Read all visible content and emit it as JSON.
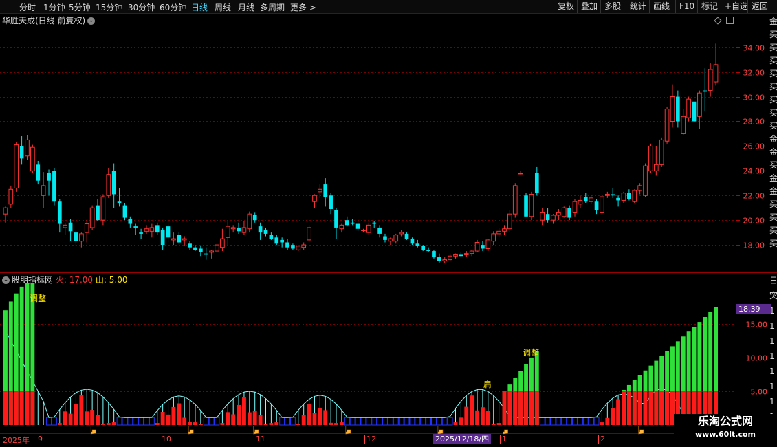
{
  "toolbar": {
    "left": [
      "分时",
      "1分钟",
      "5分钟",
      "15分钟",
      "30分钟",
      "60分钟",
      "日线",
      "周线",
      "月线",
      "多周期",
      "更多 >"
    ],
    "active_index": 6,
    "right": [
      "复权",
      "叠加",
      "多股",
      "统计",
      "画线",
      "F10",
      "标记",
      "+自选",
      "返回"
    ]
  },
  "stock_title": "华胜天成(日线 前复权)",
  "price_axis": {
    "labels": [
      "34.00",
      "32.00",
      "30.00",
      "28.00",
      "26.00",
      "24.00",
      "22.00",
      "20.00",
      "18.00"
    ],
    "values": [
      34,
      32,
      30,
      28,
      26,
      24,
      22,
      20,
      18
    ],
    "min": 16.0,
    "max": 35.6
  },
  "indicator": {
    "name": "股朋指标网",
    "fire_label": "火: 17.00",
    "mountain_label": "山: 5.00",
    "axis_labels": [
      "15.00",
      "10.00",
      "5.00"
    ],
    "axis_values": [
      15,
      10,
      5
    ],
    "max": 21.2,
    "current_value": "18.39",
    "annotations": [
      "调整",
      "调整",
      "肩"
    ],
    "right_partial": [
      "日",
      "突",
      "1",
      "1",
      "1",
      "1",
      "1",
      "1",
      "1",
      "1"
    ]
  },
  "right_partial_chars": [
    "金",
    "买",
    "买",
    "买",
    "买",
    "买",
    "买",
    "买",
    "买",
    "金",
    "金",
    "买",
    "金",
    "金",
    "买",
    "买",
    "买",
    "买"
  ],
  "dates": {
    "year": "2025年",
    "months": [
      "9",
      "10",
      "11",
      "12",
      "1",
      "2"
    ],
    "cursor": "2025/12/18/四"
  },
  "watermark": {
    "line1": "乐淘公式网",
    "line2": "www.60lt.com"
  },
  "colors": {
    "up": "#ff3333",
    "down": "#00e8f0",
    "green_bar": "#2fe03a",
    "red_bar": "#ff1a1a",
    "cyan_line": "#7fffff",
    "blue_box": "#2233ff",
    "grid": "#7a0000"
  },
  "chart_data": {
    "type": "candlestick",
    "candles": [
      [
        20.5,
        21.1,
        19.8,
        21.0
      ],
      [
        21.3,
        22.8,
        21.0,
        22.5
      ],
      [
        22.6,
        26.3,
        22.3,
        26.1
      ],
      [
        26.0,
        26.8,
        24.5,
        25.0
      ],
      [
        25.2,
        26.9,
        24.9,
        26.5
      ],
      [
        24.0,
        26.1,
        23.8,
        25.9
      ],
      [
        24.5,
        24.8,
        22.9,
        23.2
      ],
      [
        22.0,
        23.9,
        21.0,
        22.8
      ],
      [
        23.8,
        24.1,
        22.0,
        23.2
      ],
      [
        24.0,
        24.2,
        21.2,
        21.5
      ],
      [
        21.5,
        21.7,
        19.0,
        19.7
      ],
      [
        19.4,
        19.8,
        18.8,
        19.6
      ],
      [
        19.8,
        20.1,
        18.3,
        19.1
      ],
      [
        19.0,
        19.2,
        17.9,
        18.3
      ],
      [
        18.3,
        19.0,
        17.8,
        18.9
      ],
      [
        19.0,
        20.0,
        18.2,
        19.7
      ],
      [
        19.4,
        21.2,
        19.2,
        21.0
      ],
      [
        21.2,
        21.7,
        19.9,
        20.0
      ],
      [
        20.0,
        22.1,
        19.6,
        21.9
      ],
      [
        22.0,
        24.2,
        21.8,
        23.7
      ],
      [
        24.0,
        24.6,
        21.0,
        22.1
      ],
      [
        21.5,
        22.6,
        21.1,
        21.4
      ],
      [
        21.2,
        21.4,
        20.0,
        20.2
      ],
      [
        20.1,
        20.3,
        19.4,
        19.7
      ],
      [
        19.5,
        19.7,
        18.8,
        19.4
      ],
      [
        19.0,
        19.3,
        18.5,
        18.9
      ],
      [
        19.1,
        19.6,
        18.9,
        19.3
      ],
      [
        19.1,
        19.7,
        18.6,
        19.4
      ],
      [
        19.6,
        19.8,
        18.8,
        19.0
      ],
      [
        19.2,
        19.4,
        17.6,
        18.0
      ],
      [
        19.5,
        19.7,
        18.2,
        18.6
      ],
      [
        18.4,
        19.0,
        18.0,
        18.5
      ],
      [
        18.8,
        19.0,
        18.1,
        18.2
      ],
      [
        18.4,
        18.7,
        17.9,
        18.5
      ],
      [
        18.1,
        18.3,
        17.6,
        17.8
      ],
      [
        17.8,
        18.0,
        17.5,
        17.6
      ],
      [
        17.7,
        17.9,
        17.1,
        17.4
      ],
      [
        17.3,
        17.8,
        16.8,
        17.2
      ],
      [
        17.4,
        17.6,
        16.9,
        17.5
      ],
      [
        17.5,
        18.2,
        17.3,
        18.0
      ],
      [
        17.8,
        19.3,
        17.5,
        18.5
      ],
      [
        18.6,
        19.9,
        18.0,
        19.5
      ],
      [
        19.3,
        19.6,
        19.0,
        19.4
      ],
      [
        19.4,
        19.8,
        18.9,
        19.1
      ],
      [
        19.0,
        19.9,
        18.8,
        19.4
      ],
      [
        19.3,
        20.7,
        19.0,
        20.5
      ],
      [
        20.4,
        20.6,
        19.8,
        20.0
      ],
      [
        19.5,
        19.8,
        18.4,
        19.0
      ],
      [
        19.2,
        19.4,
        18.7,
        18.9
      ],
      [
        18.8,
        19.0,
        18.4,
        18.5
      ],
      [
        18.6,
        18.8,
        18.0,
        18.1
      ],
      [
        18.4,
        18.6,
        17.8,
        18.2
      ],
      [
        18.2,
        18.5,
        17.6,
        17.8
      ],
      [
        18.0,
        18.1,
        17.6,
        17.7
      ],
      [
        17.6,
        18.0,
        17.5,
        17.9
      ],
      [
        17.8,
        18.2,
        17.6,
        18.0
      ],
      [
        18.4,
        19.6,
        18.2,
        19.4
      ],
      [
        21.5,
        22.1,
        21.0,
        22.0
      ],
      [
        22.3,
        22.9,
        21.8,
        22.5
      ],
      [
        22.9,
        23.4,
        21.1,
        21.9
      ],
      [
        22.0,
        22.2,
        20.5,
        20.9
      ],
      [
        20.8,
        21.0,
        18.5,
        19.4
      ],
      [
        19.3,
        19.7,
        19.0,
        19.6
      ],
      [
        20.0,
        20.3,
        19.5,
        19.6
      ],
      [
        19.8,
        20.1,
        19.6,
        19.7
      ],
      [
        19.7,
        19.9,
        19.1,
        19.3
      ],
      [
        19.2,
        19.3,
        19.0,
        19.2
      ],
      [
        19.0,
        19.8,
        18.8,
        19.6
      ],
      [
        19.8,
        19.9,
        19.4,
        19.7
      ],
      [
        19.4,
        19.6,
        18.6,
        18.9
      ],
      [
        18.7,
        18.9,
        18.2,
        18.4
      ],
      [
        18.3,
        18.6,
        18.0,
        18.5
      ],
      [
        18.3,
        18.9,
        18.1,
        18.8
      ],
      [
        18.9,
        19.2,
        18.7,
        19.0
      ],
      [
        18.9,
        19.0,
        18.4,
        18.5
      ],
      [
        18.5,
        18.6,
        18.0,
        18.1
      ],
      [
        18.1,
        18.4,
        17.8,
        17.9
      ],
      [
        17.9,
        18.0,
        17.5,
        17.6
      ],
      [
        17.6,
        17.8,
        17.4,
        17.5
      ],
      [
        17.5,
        17.6,
        16.9,
        17.0
      ],
      [
        17.0,
        17.3,
        16.5,
        16.7
      ],
      [
        16.7,
        17.0,
        16.5,
        16.8
      ],
      [
        16.8,
        17.3,
        16.7,
        17.1
      ],
      [
        17.1,
        17.3,
        16.9,
        17.2
      ],
      [
        17.2,
        17.4,
        17.0,
        17.1
      ],
      [
        17.2,
        17.5,
        17.0,
        17.3
      ],
      [
        17.3,
        17.6,
        17.1,
        17.5
      ],
      [
        17.5,
        18.4,
        17.4,
        18.2
      ],
      [
        18.0,
        18.3,
        17.5,
        17.7
      ],
      [
        17.7,
        18.5,
        17.5,
        18.4
      ],
      [
        18.3,
        19.1,
        18.0,
        18.9
      ],
      [
        18.9,
        19.4,
        18.6,
        19.1
      ],
      [
        19.1,
        19.6,
        18.8,
        19.3
      ],
      [
        19.3,
        20.8,
        19.0,
        20.5
      ],
      [
        20.5,
        23.0,
        20.2,
        22.8
      ],
      [
        23.8,
        24.0,
        23.7,
        23.8
      ],
      [
        22.0,
        22.2,
        20.3,
        20.3
      ],
      [
        20.3,
        22.3,
        20.0,
        22.1
      ],
      [
        23.8,
        24.3,
        22.0,
        22.2
      ],
      [
        20.0,
        21.0,
        19.6,
        20.6
      ],
      [
        20.5,
        21.0,
        19.8,
        20.0
      ],
      [
        20.0,
        20.5,
        19.7,
        20.4
      ],
      [
        20.4,
        20.9,
        20.0,
        20.6
      ],
      [
        20.3,
        21.1,
        20.2,
        21.0
      ],
      [
        21.0,
        21.2,
        20.0,
        20.2
      ],
      [
        20.6,
        21.7,
        20.3,
        21.5
      ],
      [
        21.3,
        22.0,
        21.0,
        21.6
      ],
      [
        21.9,
        22.2,
        21.4,
        21.5
      ],
      [
        21.5,
        22.0,
        21.3,
        21.8
      ],
      [
        21.5,
        21.7,
        20.5,
        20.8
      ],
      [
        20.6,
        22.1,
        20.4,
        21.9
      ],
      [
        22.0,
        22.3,
        21.8,
        22.1
      ],
      [
        22.1,
        22.6,
        21.8,
        22.0
      ],
      [
        21.8,
        22.0,
        21.1,
        21.6
      ],
      [
        21.6,
        22.3,
        21.4,
        22.2
      ],
      [
        22.2,
        22.5,
        21.6,
        21.7
      ],
      [
        21.5,
        22.5,
        21.4,
        22.4
      ],
      [
        22.4,
        23.0,
        22.1,
        22.8
      ],
      [
        22.0,
        24.6,
        21.9,
        24.4
      ],
      [
        24.0,
        26.2,
        23.8,
        26.0
      ],
      [
        24.0,
        26.0,
        23.6,
        24.5
      ],
      [
        24.5,
        26.7,
        24.3,
        26.5
      ],
      [
        26.4,
        29.2,
        26.2,
        29.0
      ],
      [
        28.0,
        31.0,
        27.5,
        30.0
      ],
      [
        30.0,
        30.5,
        27.5,
        28.0
      ],
      [
        27.0,
        29.0,
        26.9,
        28.4
      ],
      [
        28.3,
        30.0,
        28.0,
        29.8
      ],
      [
        29.6,
        30.0,
        27.6,
        28.0
      ],
      [
        28.4,
        30.5,
        27.4,
        30.3
      ],
      [
        30.5,
        32.3,
        28.8,
        30.4
      ],
      [
        30.5,
        32.7,
        30.0,
        32.2
      ],
      [
        31.2,
        34.3,
        30.9,
        32.6
      ]
    ],
    "indicator": {
      "green": [
        17,
        18.5,
        19.5,
        20.5,
        21,
        21,
        0,
        0,
        0,
        0,
        0,
        0,
        0,
        0,
        0,
        0,
        0,
        0,
        0,
        0,
        0,
        0,
        0,
        0,
        0,
        0,
        0,
        0,
        0,
        0,
        0,
        0,
        0,
        0,
        0,
        0,
        0,
        0,
        0,
        0,
        0,
        0,
        0,
        0,
        0,
        0,
        0,
        0,
        0,
        0,
        0,
        0,
        0,
        0,
        0,
        0,
        0,
        0,
        0,
        0,
        0,
        0,
        0,
        0,
        0,
        0,
        0,
        0,
        0,
        0,
        0,
        0,
        0,
        0,
        0,
        0,
        0,
        0,
        0,
        0,
        0,
        0,
        0,
        0,
        0,
        0,
        0,
        0,
        0,
        0,
        0,
        0,
        0,
        0,
        0,
        0,
        0,
        0,
        0,
        0,
        0,
        0,
        0,
        0,
        0,
        0,
        0,
        0,
        0,
        0,
        0,
        0,
        0,
        0,
        0,
        0,
        0,
        0,
        0,
        0,
        0,
        0,
        0,
        0,
        0,
        0,
        0,
        0,
        0,
        0,
        0,
        0,
        0,
        0,
        0,
        0,
        0,
        0,
        0,
        0,
        0,
        0,
        0,
        0,
        0,
        0,
        0,
        0,
        0,
        0,
        0,
        0,
        0,
        0,
        0,
        0,
        0,
        0,
        0,
        0,
        0,
        0,
        0,
        0,
        0,
        0,
        0,
        0,
        0,
        0,
        0,
        0,
        0,
        0,
        0,
        0,
        0,
        0,
        0,
        0,
        0,
        0,
        0,
        0,
        0,
        0,
        0,
        0,
        0,
        0,
        0,
        0,
        0,
        0,
        0,
        0,
        0,
        0,
        0,
        0,
        0,
        0,
        0,
        0,
        0,
        0,
        0,
        0,
        0,
        0
      ],
      "red_box": [
        5,
        5,
        5,
        5,
        5,
        5,
        0,
        0,
        0,
        0,
        0,
        0,
        0,
        0,
        0,
        0,
        0,
        0,
        0,
        0,
        0,
        0,
        0,
        0,
        0,
        0,
        0,
        0,
        0,
        0,
        0,
        0,
        0,
        0,
        0,
        0,
        0,
        0,
        0,
        0,
        0,
        0,
        0,
        0,
        0,
        0,
        0,
        0,
        0,
        0,
        0,
        0,
        0,
        0,
        0,
        0,
        0,
        0,
        0,
        0,
        0,
        0,
        0,
        0,
        0,
        0,
        0,
        0,
        0,
        0,
        0,
        0,
        0,
        0,
        0,
        0,
        0,
        0,
        0,
        0,
        0,
        0,
        0,
        0,
        0,
        0,
        0,
        0,
        0,
        0,
        0,
        0,
        0,
        0,
        0,
        0,
        0,
        0,
        0,
        0,
        0,
        0,
        0,
        0,
        0,
        0,
        0,
        0,
        0,
        0,
        0,
        0,
        0,
        0,
        0,
        0,
        0,
        0,
        0,
        0,
        0,
        0,
        0,
        0,
        0,
        0,
        0,
        0,
        0,
        0,
        0,
        0,
        0,
        0,
        0,
        0,
        0,
        0,
        0,
        0,
        0,
        0,
        0,
        0,
        0,
        0,
        0,
        0,
        0,
        0,
        0,
        0,
        0,
        0,
        0,
        0,
        0,
        0,
        0,
        0,
        0,
        0,
        0,
        0,
        0,
        0,
        0,
        0,
        0,
        0,
        0,
        0,
        0,
        0,
        0,
        0,
        0,
        0,
        0,
        0,
        0,
        0,
        0,
        0,
        0,
        0,
        0,
        0,
        0,
        0,
        0,
        0,
        0,
        0,
        0,
        0,
        0,
        0,
        0,
        0,
        0,
        0,
        0,
        0,
        0,
        0,
        0,
        0,
        0,
        0,
        0,
        0,
        0,
        0,
        0,
        0,
        0,
        0,
        0,
        0
      ],
      "hand_positions": [
        16,
        34,
        46,
        63,
        80,
        92,
        117
      ]
    }
  }
}
